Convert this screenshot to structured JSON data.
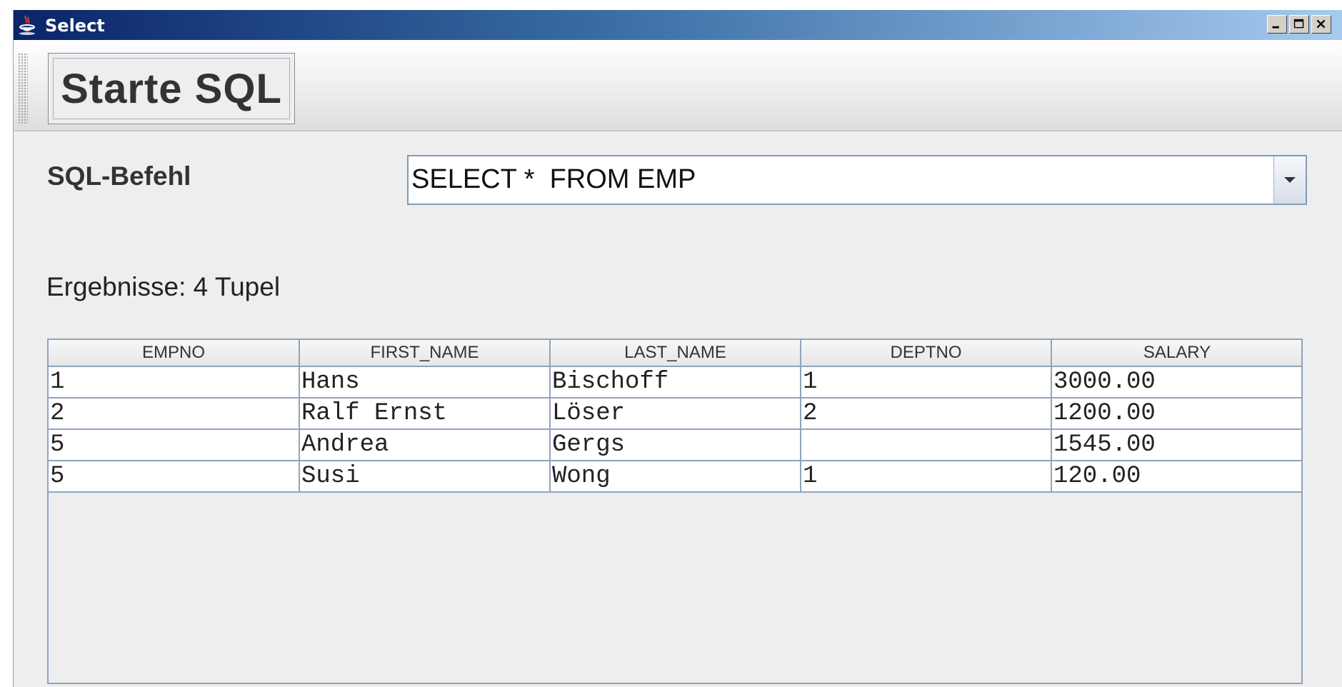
{
  "window": {
    "title": "Select",
    "app_icon": "java-coffee-cup-icon",
    "controls": [
      "minimize-icon",
      "maximize-icon",
      "close-icon"
    ]
  },
  "toolbar": {
    "start_button_label": "Starte SQL"
  },
  "form": {
    "sql_label": "SQL-Befehl",
    "sql_value": "SELECT *  FROM EMP"
  },
  "results": {
    "label": "Ergebnisse: 4 Tupel",
    "columns": [
      "EMPNO",
      "FIRST_NAME",
      "LAST_NAME",
      "DEPTNO",
      "SALARY"
    ],
    "rows": [
      [
        "1",
        "Hans",
        "Bischoff",
        "1",
        "3000.00"
      ],
      [
        "2",
        "Ralf Ernst",
        "Löser",
        "2",
        "1200.00"
      ],
      [
        "5",
        "Andrea",
        "Gergs",
        "",
        "1545.00"
      ],
      [
        "5",
        "Susi",
        "Wong",
        "1",
        "120.00"
      ]
    ]
  },
  "colors": {
    "titlebar_start": "#0a246a",
    "titlebar_end": "#a6caf0",
    "grid_line": "#8fa4bd",
    "background": "#eeeeee"
  }
}
